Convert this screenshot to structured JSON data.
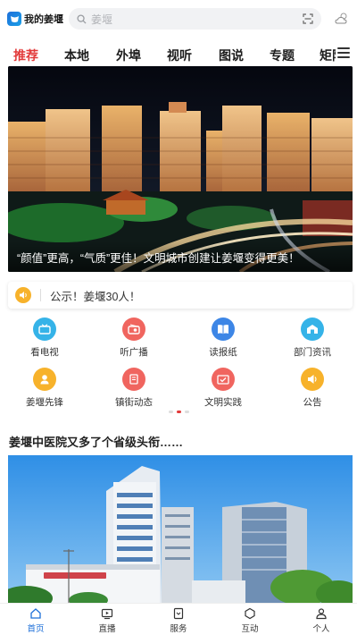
{
  "header": {
    "app_name": "我的姜堰",
    "search_placeholder": "姜堰"
  },
  "tabs": [
    {
      "label": "推荐",
      "active": true
    },
    {
      "label": "本地",
      "active": false
    },
    {
      "label": "外埠",
      "active": false
    },
    {
      "label": "视听",
      "active": false
    },
    {
      "label": "图说",
      "active": false
    },
    {
      "label": "专题",
      "active": false
    },
    {
      "label": "矩阵",
      "active": false
    }
  ],
  "banner": {
    "caption": "“颜值”更高，“气质”更佳！文明城市创建让姜堰变得更美！"
  },
  "notice": {
    "text": "公示！姜堰30人！"
  },
  "services": [
    {
      "label": "看电视",
      "icon": "tv-icon",
      "color": "#35b3e8"
    },
    {
      "label": "听广播",
      "icon": "radio-icon",
      "color": "#f0655f"
    },
    {
      "label": "读报纸",
      "icon": "newspaper-icon",
      "color": "#3d86e6"
    },
    {
      "label": "部门资讯",
      "icon": "department-news-icon",
      "color": "#35b3e8"
    },
    {
      "label": "姜堰先锋",
      "icon": "pioneer-icon",
      "color": "#f7b22b"
    },
    {
      "label": "镇街动态",
      "icon": "town-news-icon",
      "color": "#f0655f"
    },
    {
      "label": "文明实践",
      "icon": "civilization-icon",
      "color": "#f0655f"
    },
    {
      "label": "公告",
      "icon": "announcement-icon",
      "color": "#f7b22b"
    }
  ],
  "carousel_page": {
    "current": 2,
    "total": 3
  },
  "news": {
    "title": "姜堰中医院又多了个省级头衔……"
  },
  "bottom_nav": [
    {
      "label": "首页",
      "icon": "home-icon",
      "active": true
    },
    {
      "label": "直播",
      "icon": "live-icon",
      "active": false
    },
    {
      "label": "服务",
      "icon": "service-icon",
      "active": false
    },
    {
      "label": "互动",
      "icon": "interact-icon",
      "active": false
    },
    {
      "label": "个人",
      "icon": "profile-icon",
      "active": false
    }
  ],
  "colors": {
    "accent_red": "#e23a3a",
    "brand_blue": "#1d6fd8",
    "notice_yellow": "#f7b22b"
  }
}
